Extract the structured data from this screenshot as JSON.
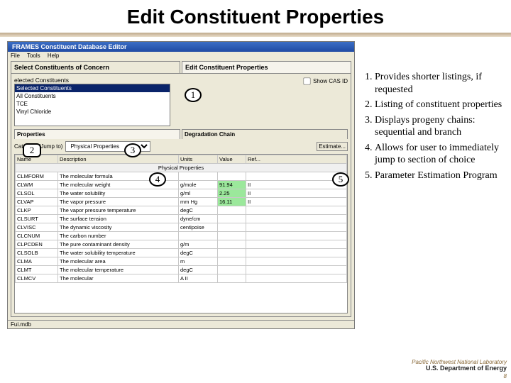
{
  "slide": {
    "title": "Edit Constituent Properties",
    "page_number": "8"
  },
  "window": {
    "title": "FRAMES Constituent Database Editor",
    "menu": [
      "File",
      "Tools",
      "Help"
    ],
    "tabs": {
      "select": "Select Constituents of Concern",
      "edit": "Edit Constituent Properties"
    },
    "list_label": "elected Constituents",
    "list_items": [
      "Selected Constituents",
      "All Constituents",
      "TCE",
      "Vinyl Chloride"
    ],
    "show_cas": "Show CAS ID",
    "subtabs": {
      "props": "Properties",
      "chain": "Degradation Chain"
    },
    "category_label": "Category (Jump to)",
    "category_value": "Physical Properties",
    "estimate_btn": "Estimate...",
    "grid_headers": [
      "Name",
      "Description",
      "Units",
      "Value",
      "Ref..."
    ],
    "group_header": "Physical Properties",
    "rows": [
      {
        "n": "CLMFORM",
        "d": "The molecular formula",
        "u": "",
        "v": "",
        "r": ""
      },
      {
        "n": "CLWM",
        "d": "The molecular weight",
        "u": "g/mole",
        "v": "91.94",
        "r": "II",
        "g": true
      },
      {
        "n": "CLSOL",
        "d": "The water solubility",
        "u": "g/ml",
        "v": "2.25",
        "r": "II",
        "g": true
      },
      {
        "n": "CLVAP",
        "d": "The vapor pressure",
        "u": "mm Hg",
        "v": "16.11",
        "r": "II",
        "g": true
      },
      {
        "n": "CLKP",
        "d": "The vapor pressure temperature",
        "u": "degC",
        "v": "",
        "r": ""
      },
      {
        "n": "CLSURT",
        "d": "The surface tension",
        "u": "dyne/cm",
        "v": "",
        "r": ""
      },
      {
        "n": "CLVISC",
        "d": "The dynamic viscosity",
        "u": "centipoise",
        "v": "",
        "r": ""
      },
      {
        "n": "CLCNUM",
        "d": "The carbon number",
        "u": "",
        "v": "",
        "r": ""
      },
      {
        "n": "CLPCDEN",
        "d": "The pure contaminant density",
        "u": "g/m",
        "v": "",
        "r": ""
      },
      {
        "n": "CLSOLB",
        "d": "The water solubility temperature",
        "u": "degC",
        "v": "",
        "r": ""
      },
      {
        "n": "CLMA",
        "d": "The molecular area",
        "u": "m",
        "v": "",
        "r": ""
      },
      {
        "n": "CLMT",
        "d": "The molecular temperature",
        "u": "degC",
        "v": "",
        "r": ""
      },
      {
        "n": "CLMCV",
        "d": "The molecular",
        "u": "A II",
        "v": "",
        "r": ""
      }
    ],
    "status_left": "Fui.mdb",
    "status_right": ""
  },
  "callouts": [
    "1",
    "2",
    "3",
    "4",
    "5"
  ],
  "legend": [
    "Provides shorter listings, if requested",
    "Listing of constituent properties",
    "Displays progeny chains:  sequential and branch",
    "Allows for user to immediately jump to section of choice",
    "Parameter Estimation Program"
  ],
  "footer": {
    "lab": "Pacific Northwest National Laboratory",
    "doe": "U.S. Department of Energy"
  }
}
